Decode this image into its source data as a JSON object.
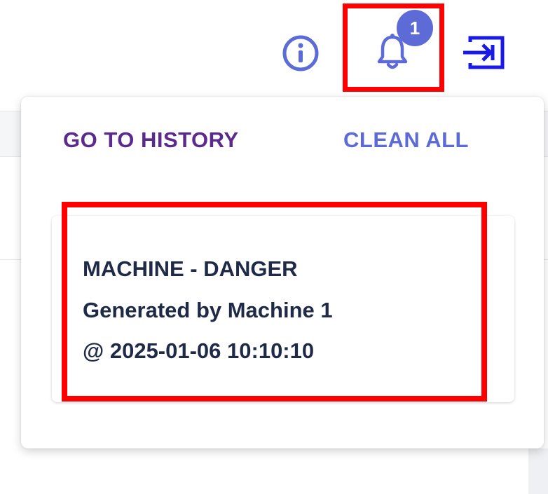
{
  "toolbar": {
    "info_icon": "info-circle-icon",
    "bell_icon": "bell-icon",
    "logout_icon": "logout-arrow-icon",
    "notification_count": "1",
    "accent_color": "#5c6bd6",
    "logout_color": "#1a1ae6"
  },
  "notifications_popover": {
    "go_to_history_label": "GO TO HISTORY",
    "clean_all_label": "CLEAN ALL",
    "items": [
      {
        "title": "MACHINE - DANGER",
        "source": "Generated by Machine 1",
        "timestamp": "@ 2025-01-06 10:10:10"
      }
    ]
  },
  "highlight_color": "#ff0000"
}
